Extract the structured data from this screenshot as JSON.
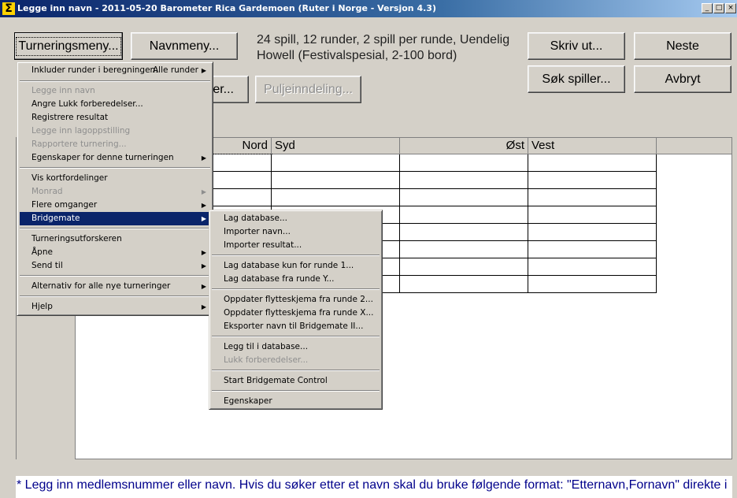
{
  "window": {
    "title": "Legge inn navn - 2011-05-20  Barometer Rica Gardemoen  (Ruter i Norge - Versjon 4.3)",
    "app_icon": "Σ",
    "controls": {
      "minimize": "_",
      "maximize": "□",
      "close": "×"
    }
  },
  "buttons": {
    "turneringsmeny": "Turneringsmeny...",
    "navnmeny": "Navnmeny...",
    "hidden_btn": "er...",
    "puljeinndeling": "Puljeinndeling...",
    "skriv_ut": "Skriv ut...",
    "neste": "Neste",
    "sok_spiller": "Søk spiller...",
    "avbryt": "Avbryt"
  },
  "info": "24 spill, 12 runder, 2 spill per runde, Uendelig Howell (Festivalspesial, 2-100 bord)",
  "grid": {
    "headers": [
      "Nord",
      "Syd",
      "Øst",
      "Vest"
    ]
  },
  "hint": "* Legg inn medlemsnummer eller navn. Hvis du søker etter et navn skal du bruke følgende format: \"Etternavn,Fornavn\" direkte i",
  "main_menu": {
    "items": [
      {
        "label": "Inkluder runder i beregningen:",
        "value": "Alle runder",
        "submenu": true
      },
      {
        "label": "Legge inn navn",
        "disabled": true
      },
      {
        "label": "Angre Lukk forberedelser..."
      },
      {
        "label": "Registrere resultat"
      },
      {
        "label": "Legge inn lagoppstilling",
        "disabled": true
      },
      {
        "label": "Rapportere turnering...",
        "disabled": true
      },
      {
        "label": "Egenskaper for denne turneringen",
        "submenu": true
      },
      {
        "label": "Vis kortfordelinger"
      },
      {
        "label": "Monrad",
        "disabled": true,
        "submenu": true
      },
      {
        "label": "Flere omganger",
        "submenu": true
      },
      {
        "label": "Bridgemate",
        "submenu": true,
        "highlighted": true
      },
      {
        "label": "Turneringsutforskeren"
      },
      {
        "label": "Åpne",
        "submenu": true
      },
      {
        "label": "Send til",
        "submenu": true
      },
      {
        "label": "Alternativ for alle nye turneringer",
        "submenu": true
      },
      {
        "label": "Hjelp",
        "submenu": true
      }
    ]
  },
  "bridgemate_menu": {
    "items": [
      {
        "label": "Lag database..."
      },
      {
        "label": "Importer navn..."
      },
      {
        "label": "Importer resultat..."
      },
      {
        "label": "Lag database kun for runde 1..."
      },
      {
        "label": "Lag database fra runde Y..."
      },
      {
        "label": "Oppdater flytteskjema fra runde 2..."
      },
      {
        "label": "Oppdater flytteskjema fra runde X..."
      },
      {
        "label": "Eksporter navn til Bridgemate II..."
      },
      {
        "label": "Legg til i database..."
      },
      {
        "label": "Lukk forberedelser...",
        "disabled": true
      },
      {
        "label": "Start Bridgemate Control"
      },
      {
        "label": "Egenskaper"
      }
    ]
  },
  "icons": {
    "submenu_arrow": "▶"
  }
}
